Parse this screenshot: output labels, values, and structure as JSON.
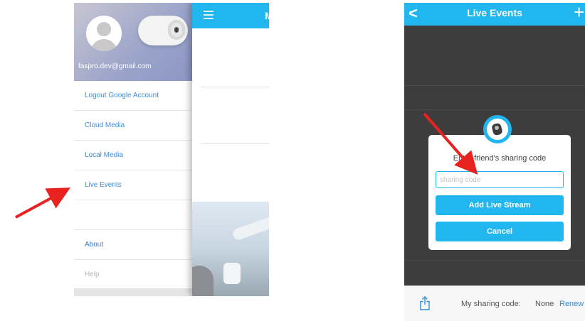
{
  "left_panel": {
    "account_email": "faspro.dev@gmail.com",
    "menu_items": [
      {
        "label": "Logout Google Account"
      },
      {
        "label": "Cloud Media"
      },
      {
        "label": "Local Media"
      },
      {
        "label": "Live Events"
      },
      {
        "label": ""
      },
      {
        "label": "About"
      },
      {
        "label": "Help"
      }
    ],
    "main_title_fragment": "M"
  },
  "right_panel": {
    "nav_title": "Live Events",
    "back_icon": "<",
    "add_icon": "+",
    "dialog": {
      "prompt": "Enter friend's sharing code",
      "input_placeholder": "sharing code",
      "input_value": "",
      "add_button_label": "Add Live Stream",
      "cancel_button_label": "Cancel"
    },
    "footer": {
      "my_sharing_code_label": "My sharing code:",
      "my_sharing_code_value": "None",
      "renew_label": "Renew"
    }
  },
  "colors": {
    "accent": "#22b6ef",
    "link": "#3d8ed8",
    "annotation_arrow": "#e8231f"
  },
  "icons": [
    "menu-icon",
    "back-icon",
    "add-icon",
    "camera-icon",
    "share-icon",
    "avatar-icon"
  ]
}
